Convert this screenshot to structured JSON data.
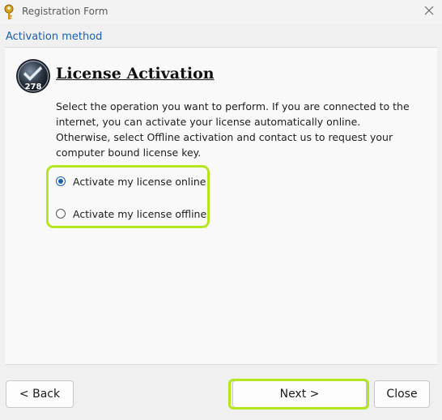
{
  "window": {
    "title": "Registration Form",
    "icon": "key-icon",
    "close_icon": "close-icon"
  },
  "section": {
    "label": "Activation method"
  },
  "badge": {
    "number": "278",
    "icon": "checkmark-badge-icon"
  },
  "content": {
    "heading": "License Activation",
    "description": "Select the operation you want to perform. If you are connected to the internet, you can activate your license automatically online. Otherwise, select Offline activation and contact us to request your computer bound license key."
  },
  "options": [
    {
      "label": "Activate my license online",
      "selected": true
    },
    {
      "label": "Activate my license offline",
      "selected": false
    }
  ],
  "buttons": {
    "back": "< Back",
    "next": "Next >",
    "close": "Close"
  },
  "colors": {
    "accent": "#1a5fb4",
    "highlight": "#b5e61d",
    "panel": "#f9f9f9",
    "background": "#f0f0f0"
  }
}
